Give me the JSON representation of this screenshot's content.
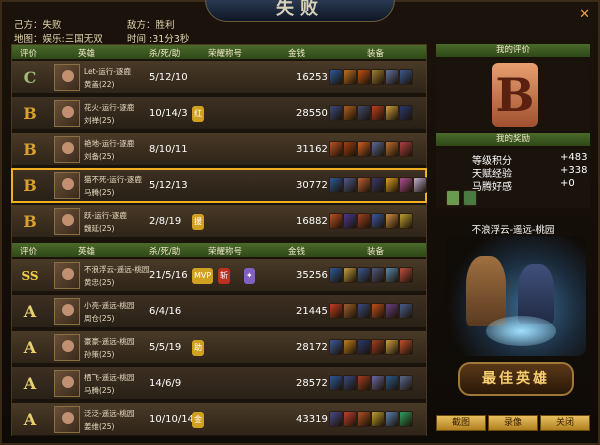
{
  "banner": {
    "title": "失败"
  },
  "header": {
    "own_side": "己方：失败",
    "enemy_side": "敌方：胜利",
    "map": "地图：娱乐:三国无双",
    "time": "时间 :31分3秒"
  },
  "top_table": {
    "headers": [
      "评价",
      "英雄",
      "杀/死/助",
      "荣耀称号",
      "金钱",
      "装备"
    ],
    "rows": [
      {
        "grade": "C",
        "line1": "Let-运行-逐鹿",
        "line2": "黄盖(22)",
        "kda": "5/12/10",
        "honors": [],
        "money": "16253",
        "equip": [
          "#2a5aa0",
          "#c07020",
          "#c05010",
          "#a08030",
          "#6070a0",
          "#3a5a90"
        ]
      },
      {
        "grade": "B",
        "line1": "花火-运行-逐鹿",
        "line2": "刘禅(25)",
        "kda": "10/14/3",
        "honors": [
          "红"
        ],
        "money": "28550",
        "equip": [
          "#3a4a80",
          "#b06020",
          "#404a70",
          "#c04020",
          "#d0a040",
          "#2a3a70"
        ]
      },
      {
        "grade": "B",
        "line1": "艳地-运行-逐鹿",
        "line2": "刘备(25)",
        "kda": "8/10/11",
        "honors": [],
        "money": "31162",
        "equip": [
          "#c05020",
          "#a04010",
          "#d06020",
          "#5a6a90",
          "#c07030",
          "#b04040"
        ]
      },
      {
        "grade": "B",
        "line1": "猫不死-运行-逐鹿",
        "line2": "马腾(25)",
        "kda": "5/12/13",
        "honors": [],
        "money": "30772",
        "equip": [
          "#2a5aa0",
          "#505a8a",
          "#c06030",
          "#3a3a6a",
          "#e0a020",
          "#b05090",
          "#c0b0d0"
        ]
      },
      {
        "grade": "B",
        "line1": "跃-运行-逐鹿",
        "line2": "魏延(25)",
        "kda": "2/8/19",
        "honors": [
          "援"
        ],
        "money": "16882",
        "equip": [
          "#c05020",
          "#4a3a90",
          "#a04020",
          "#3a5aa0",
          "#d09040",
          "#c0a030"
        ]
      }
    ]
  },
  "bottom_table": {
    "headers": [
      "评价",
      "英雄",
      "杀/死/助",
      "荣耀称号",
      "金钱",
      "装备"
    ],
    "rows": [
      {
        "grade": "SS",
        "line1": "不浪浮云-遥远-桃园",
        "line2": "黄忠(25)",
        "kda": "21/5/16",
        "honors": [
          "MVP",
          "斩",
          "✦"
        ],
        "money": "35256",
        "equip": [
          "#2a5aa0",
          "#c0a040",
          "#3a5a90",
          "#505a80",
          "#5a8ab0",
          "#c05040"
        ]
      },
      {
        "grade": "A",
        "line1": "小亮-遥远-桃园",
        "line2": "周仓(25)",
        "kda": "6/4/16",
        "honors": [],
        "money": "21445",
        "equip": [
          "#c04020",
          "#a06030",
          "#3a4a80",
          "#c05020",
          "#6a4080",
          "#4a6090"
        ]
      },
      {
        "grade": "A",
        "line1": "豪豪-遥远-桃园",
        "line2": "孙策(25)",
        "kda": "5/5/19",
        "honors": [
          "助"
        ],
        "money": "28172",
        "equip": [
          "#3a5aa0",
          "#c08020",
          "#2a3a70",
          "#a04020",
          "#d0a040",
          "#c05030"
        ]
      },
      {
        "grade": "A",
        "line1": "栖飞-遥远-桃园",
        "line2": "马腾(25)",
        "kda": "14/6/9",
        "honors": [],
        "money": "28572",
        "equip": [
          "#2a5aa0",
          "#3a4a80",
          "#a04020",
          "#6a6aa0",
          "#2a5a90",
          "#5a6a90"
        ]
      },
      {
        "grade": "A",
        "line1": "泛泛-遥远-桃园",
        "line2": "姜维(25)",
        "kda": "10/10/14",
        "honors": [
          "金"
        ],
        "money": "43319",
        "equip": [
          "#4a4a8a",
          "#c04030",
          "#b05020",
          "#c0a030",
          "#5a80b0",
          "#30a060"
        ]
      }
    ]
  },
  "right": {
    "my_eval_label": "我的评价",
    "my_grade": "B",
    "my_reward_label": "我的奖励",
    "rewards": [
      {
        "label": "等级积分",
        "value": "+483"
      },
      {
        "label": "天赋经验",
        "value": "+338"
      },
      {
        "label": "马腾好感",
        "value": "+0"
      }
    ],
    "best_player": "不浪浮云-遥远-桃园",
    "best_plaque": "最佳英雄",
    "buttons": {
      "screenshot": "截图",
      "record": "录像",
      "close": "关闭"
    }
  }
}
